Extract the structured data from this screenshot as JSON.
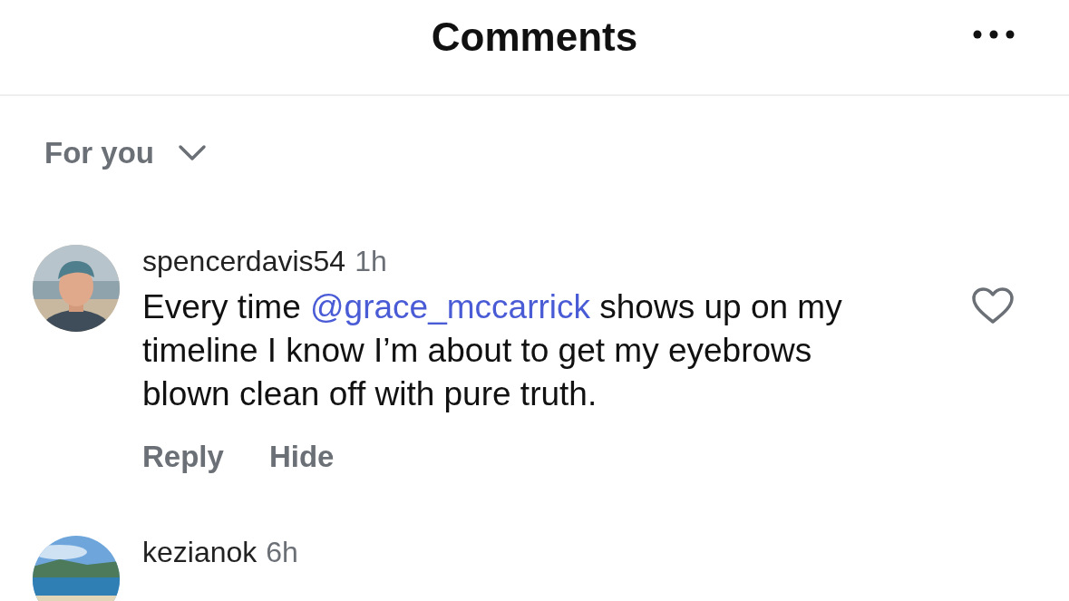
{
  "header": {
    "title": "Comments"
  },
  "filter": {
    "label": "For you"
  },
  "comments": [
    {
      "username": "spencerdavis54",
      "time": "1h",
      "text_before": "Every time ",
      "mention": "@grace_mccarrick",
      "text_after": " shows up on my timeline I know I’m about to get my eyebrows blown clean off with pure truth.",
      "actions": [
        "Reply",
        "Hide"
      ],
      "liked": false
    },
    {
      "username": "kezianok",
      "time": "6h"
    }
  ]
}
